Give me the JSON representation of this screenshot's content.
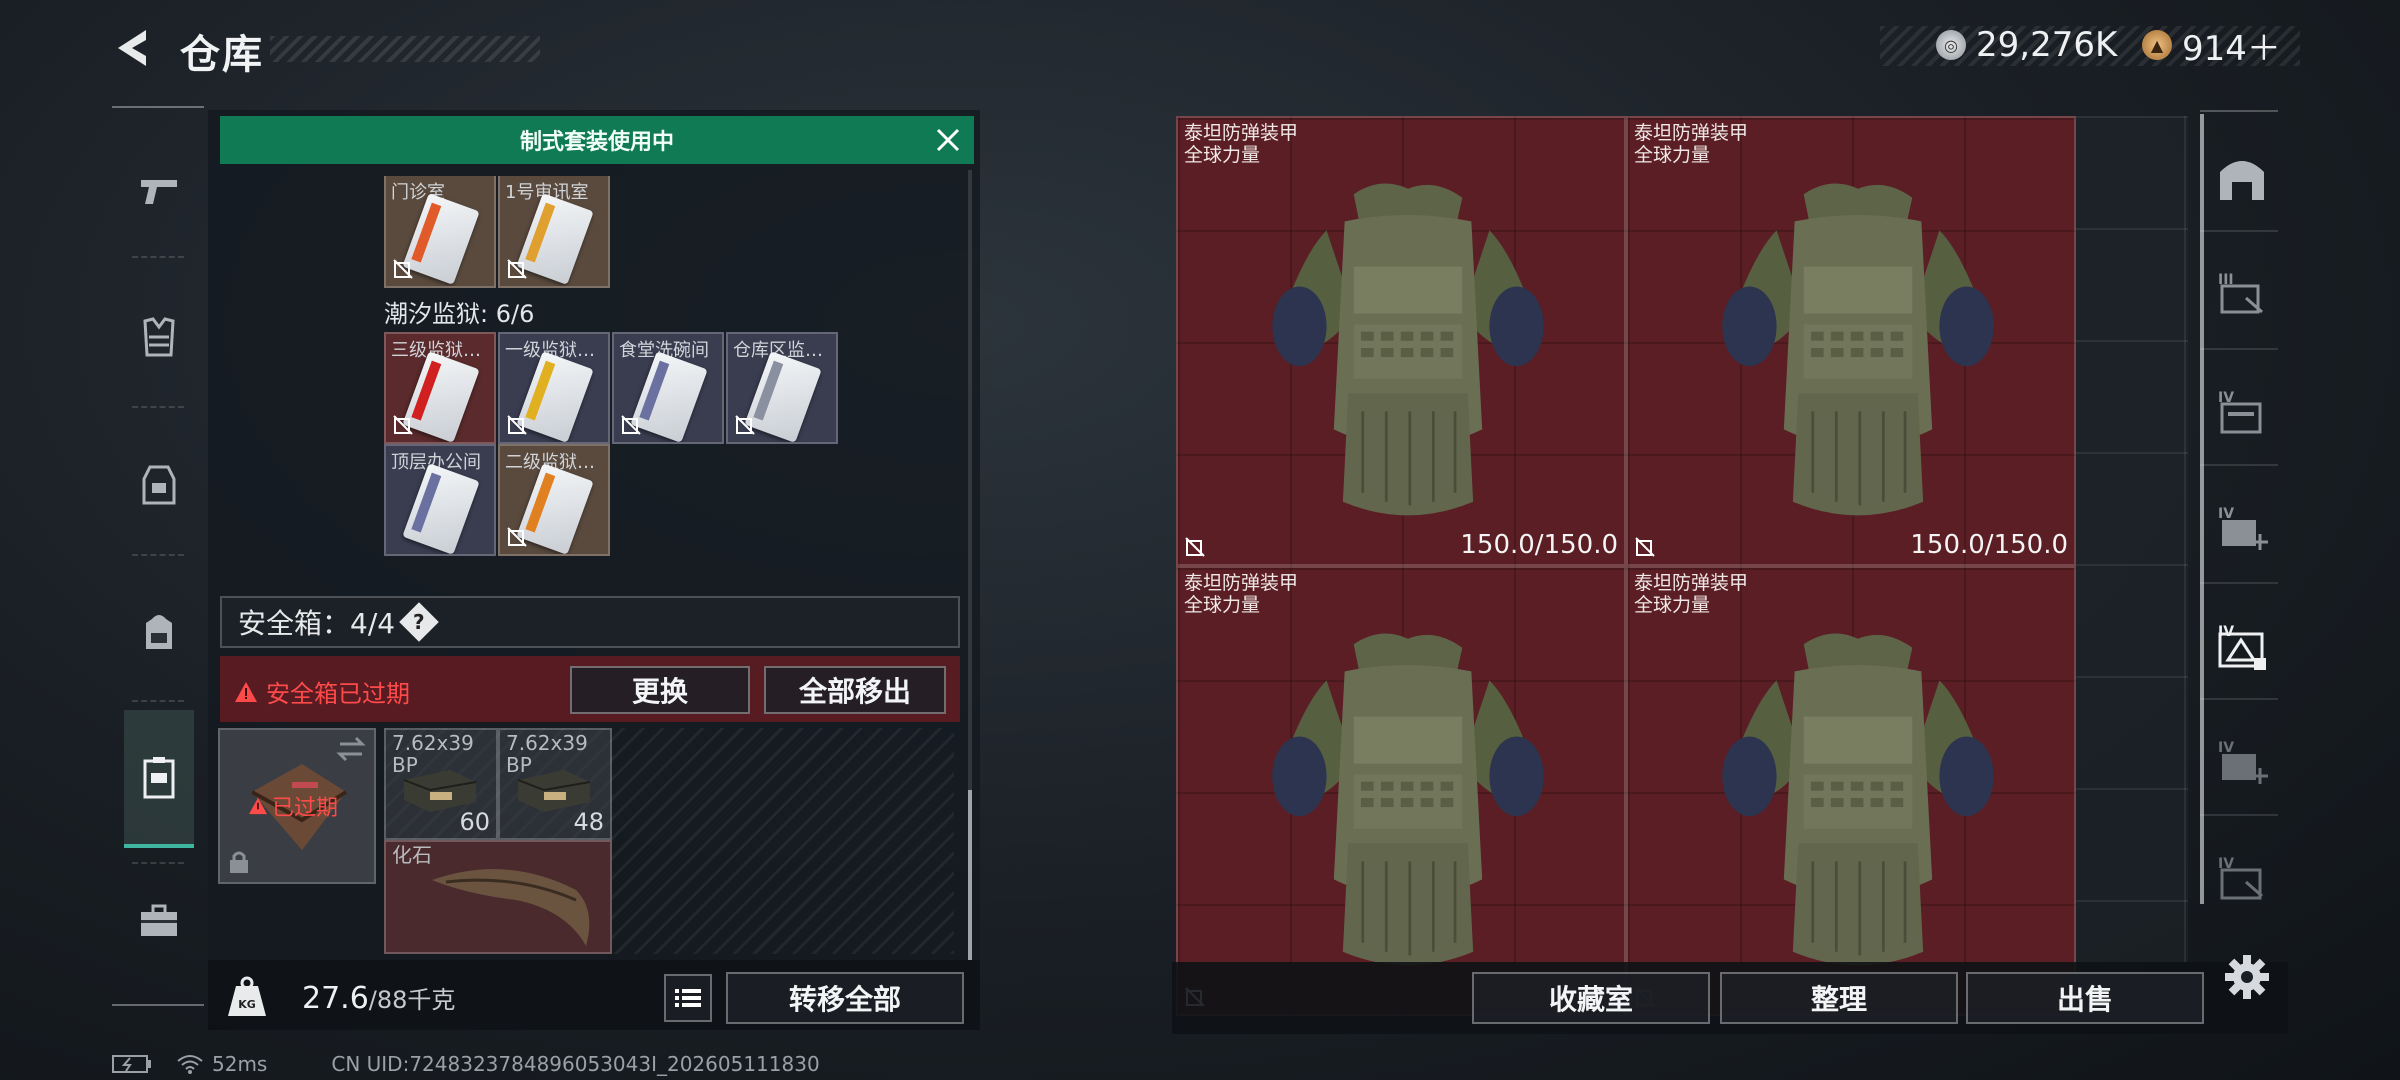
{
  "header": {
    "title": "仓库",
    "currency": [
      {
        "icon": "silver-coin-icon",
        "value": "29,276K"
      },
      {
        "icon": "gold-coin-icon",
        "value": "914＋"
      }
    ]
  },
  "nav": {
    "items": [
      {
        "icon": "pistol-icon"
      },
      {
        "icon": "vest-icon"
      },
      {
        "icon": "chest-rig-icon"
      },
      {
        "icon": "backpack-icon"
      },
      {
        "icon": "safe-case-icon",
        "active": true
      },
      {
        "icon": "briefcase-icon"
      }
    ]
  },
  "left_panel": {
    "banner": "制式套装使用中",
    "group1_keys": [
      {
        "label": "门诊室",
        "color": "#e05a2a"
      },
      {
        "label": "1号审讯室",
        "color": "#e0a030"
      }
    ],
    "group2_label": "潮汐监狱: 6/6",
    "group2_keys": [
      {
        "label": "三级监狱…",
        "color": "#d02020"
      },
      {
        "label": "一级监狱…",
        "color": "#e0b020"
      },
      {
        "label": "食堂洗碗间",
        "color": "#6a70a0"
      },
      {
        "label": "仓库区监…",
        "color": "#8a90a0"
      },
      {
        "label": "顶层办公间",
        "color": "#6a70a0"
      },
      {
        "label": "二级监狱…",
        "color": "#e08020"
      }
    ],
    "safe_box_label": "安全箱：4/4",
    "help": "?",
    "expired_warning": "安全箱已过期",
    "replace_button": "更换",
    "remove_all_button": "全部移出",
    "safe_case_status": "已过期",
    "items": [
      {
        "label": "7.62x39\nBP",
        "count": "60"
      },
      {
        "label": "7.62x39\nBP",
        "count": "48"
      },
      {
        "label": "化石",
        "count": ""
      }
    ],
    "weight_current": "27.6",
    "weight_max": "/88千克",
    "transfer_all_button": "转移全部"
  },
  "right_panel": {
    "armors": [
      {
        "name": "泰坦防弹装甲",
        "brand": "全球力量",
        "durability": "150.0/150.0"
      },
      {
        "name": "泰坦防弹装甲",
        "brand": "全球力量",
        "durability": "150.0/150.0"
      },
      {
        "name": "泰坦防弹装甲",
        "brand": "全球力量",
        "durability": ""
      },
      {
        "name": "泰坦防弹装甲",
        "brand": "全球力量",
        "durability": ""
      }
    ],
    "buttons": {
      "collection": "收藏室",
      "organize": "整理",
      "sell": "出售"
    }
  },
  "right_rail": {
    "items": [
      {
        "icon": "hideout-icon"
      },
      {
        "icon": "tier-3-case-icon"
      },
      {
        "icon": "tier-4-case-icon"
      },
      {
        "icon": "tier-4-medkit-icon"
      },
      {
        "icon": "tier-4-safe-icon",
        "active": true
      },
      {
        "icon": "tier-4-medkit-icon-2"
      },
      {
        "icon": "tier-4-case-icon-2"
      }
    ],
    "settings": "gear-icon"
  },
  "status_bar": {
    "ping": "52ms",
    "uid": "CN UID:7248323784896053043I_202605111830"
  },
  "colors": {
    "accent_green": "#0f7a54",
    "warning_red": "#ff4a4a",
    "armor_bg": "#5a1e24"
  }
}
